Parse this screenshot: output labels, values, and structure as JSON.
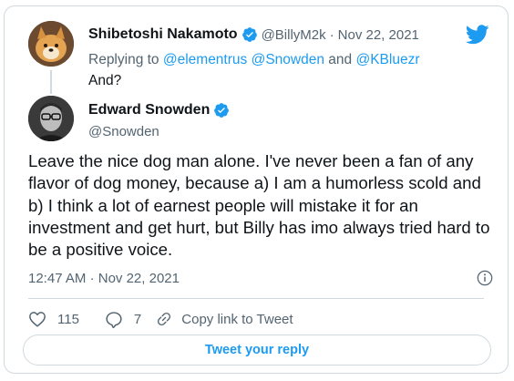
{
  "parent_tweet": {
    "author_name": "Shibetoshi Nakamoto",
    "handle": "@BillyM2k",
    "separator": "·",
    "date": "Nov 22, 2021",
    "replying_prefix": "Replying to",
    "replying_mentions": [
      "@elementrus",
      "@Snowden",
      "@KBluezr"
    ],
    "replying_and": "and",
    "text": "And?"
  },
  "main_tweet": {
    "author_name": "Edward Snowden",
    "handle": "@Snowden",
    "body": "Leave the nice dog man alone. I've never been a fan of any flavor of dog money, because a) I am a humorless scold and b) I think a lot of earnest people will mistake it for an investment and get hurt, but Billy has imo always tried hard to be a positive voice.",
    "time": "12:47 AM",
    "separator": "·",
    "date": "Nov 22, 2021"
  },
  "actions": {
    "likes": "115",
    "replies": "7",
    "copy_link": "Copy link to Tweet"
  },
  "reply_button": "Tweet your reply",
  "icons": {
    "verified": "verified-badge-icon",
    "logo": "twitter-bird-icon",
    "like": "heart-icon",
    "reply": "reply-bubble-icon",
    "copy": "link-icon",
    "info": "info-icon"
  },
  "colors": {
    "accent": "#1d9bf0",
    "secondary_text": "#536471",
    "border": "#cfd9de"
  }
}
